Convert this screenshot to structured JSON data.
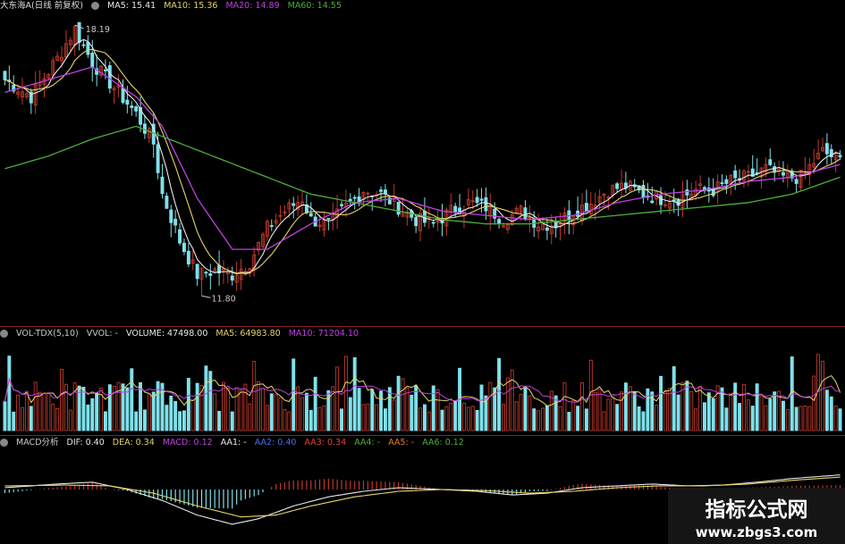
{
  "colors": {
    "up": "#c0392b",
    "down": "#7fe0ea",
    "white": "#e8e8e8",
    "yellow": "#e6d36a",
    "magenta": "#c040e0",
    "green": "#4caf3a",
    "blue": "#4a6be8",
    "red": "#e04040",
    "orange": "#e08020",
    "label": "#c8c8c8"
  },
  "main_header": {
    "title": "大东海A(日线 前复权)",
    "ma5": "MA5: 15.41",
    "ma10": "MA10: 15.36",
    "ma20": "MA20: 14.89",
    "ma60": "MA60: 14.55"
  },
  "vol_header": {
    "title": "VOL-TDX(5,10)",
    "vvol": "VVOL: -",
    "volume": "VOLUME: 47498.00",
    "ma5": "MA5: 64983.80",
    "ma10": "MA10: 71204.10"
  },
  "macd_header": {
    "title": "MACD分析",
    "dif": "DIF: 0.40",
    "dea": "DEA: 0.34",
    "macd": "MACD: 0.12",
    "aa1": "AA1: -",
    "aa2": "AA2: 0.40",
    "aa3": "AA3: 0.34",
    "aa4": "AA4: -",
    "aa5": "AA5: -",
    "aa6": "AA6: 0.12"
  },
  "annotations": {
    "high": "18.19",
    "low": "11.80"
  },
  "watermark": {
    "title": "指标公式网",
    "url": "www.zbgs3.com"
  },
  "chart_data": [
    {
      "type": "candlestick",
      "price_range": [
        11.3,
        18.4
      ],
      "high_value": 18.19,
      "low_value": 11.8,
      "close_keyframes": [
        [
          0,
          16.9
        ],
        [
          6,
          16.5
        ],
        [
          12,
          17.4
        ],
        [
          16,
          18.1
        ],
        [
          20,
          17.3
        ],
        [
          26,
          16.6
        ],
        [
          30,
          16.1
        ],
        [
          34,
          15.4
        ],
        [
          36,
          14.2
        ],
        [
          40,
          13.1
        ],
        [
          44,
          12.3
        ],
        [
          48,
          12.4
        ],
        [
          52,
          12.3
        ],
        [
          56,
          12.6
        ],
        [
          60,
          13.4
        ],
        [
          64,
          13.8
        ],
        [
          68,
          14.1
        ],
        [
          70,
          13.6
        ],
        [
          74,
          13.5
        ],
        [
          78,
          13.9
        ],
        [
          82,
          14.3
        ],
        [
          86,
          14.2
        ],
        [
          90,
          13.9
        ],
        [
          94,
          13.6
        ],
        [
          98,
          13.5
        ],
        [
          102,
          13.8
        ],
        [
          106,
          14.0
        ],
        [
          110,
          13.9
        ],
        [
          114,
          13.6
        ],
        [
          118,
          13.8
        ],
        [
          122,
          13.5
        ],
        [
          126,
          13.5
        ],
        [
          130,
          13.8
        ],
        [
          134,
          14.0
        ],
        [
          138,
          14.3
        ],
        [
          142,
          14.4
        ],
        [
          146,
          14.2
        ],
        [
          150,
          14.1
        ],
        [
          154,
          14.1
        ],
        [
          158,
          14.3
        ],
        [
          162,
          14.3
        ],
        [
          166,
          14.5
        ],
        [
          170,
          14.6
        ],
        [
          174,
          14.8
        ],
        [
          178,
          14.6
        ],
        [
          182,
          14.6
        ],
        [
          187,
          15.2
        ],
        [
          191,
          15.0
        ]
      ],
      "ma_keyframes": {
        "ma20": [
          [
            0,
            16.6
          ],
          [
            10,
            16.9
          ],
          [
            20,
            17.2
          ],
          [
            30,
            16.5
          ],
          [
            36,
            15.8
          ],
          [
            44,
            14.1
          ],
          [
            52,
            12.9
          ],
          [
            60,
            12.9
          ],
          [
            70,
            13.5
          ],
          [
            80,
            14.0
          ],
          [
            90,
            14.1
          ],
          [
            100,
            13.8
          ],
          [
            110,
            13.7
          ],
          [
            120,
            13.6
          ],
          [
            130,
            13.7
          ],
          [
            140,
            14.0
          ],
          [
            150,
            14.2
          ],
          [
            160,
            14.3
          ],
          [
            170,
            14.5
          ],
          [
            180,
            14.6
          ],
          [
            191,
            14.9
          ]
        ],
        "ma60": [
          [
            0,
            14.8
          ],
          [
            10,
            15.1
          ],
          [
            20,
            15.5
          ],
          [
            30,
            15.8
          ],
          [
            40,
            15.4
          ],
          [
            50,
            15.0
          ],
          [
            60,
            14.6
          ],
          [
            70,
            14.2
          ],
          [
            80,
            14.0
          ],
          [
            90,
            13.8
          ],
          [
            100,
            13.6
          ],
          [
            110,
            13.5
          ],
          [
            120,
            13.5
          ],
          [
            130,
            13.6
          ],
          [
            140,
            13.7
          ],
          [
            150,
            13.8
          ],
          [
            160,
            13.9
          ],
          [
            170,
            14.0
          ],
          [
            180,
            14.2
          ],
          [
            191,
            14.6
          ]
        ]
      }
    },
    {
      "type": "bar",
      "name": "volume",
      "last_volume": 47498.0,
      "ma5": 64983.8,
      "ma10": 71204.1
    },
    {
      "type": "histogram",
      "name": "macd",
      "dif": 0.4,
      "dea": 0.34,
      "macd": 0.12,
      "dif_keyframes": [
        [
          0,
          0.05
        ],
        [
          12,
          0.15
        ],
        [
          20,
          0.2
        ],
        [
          28,
          0.0
        ],
        [
          36,
          -0.3
        ],
        [
          44,
          -0.7
        ],
        [
          52,
          -0.95
        ],
        [
          58,
          -0.8
        ],
        [
          66,
          -0.45
        ],
        [
          74,
          -0.2
        ],
        [
          82,
          -0.05
        ],
        [
          90,
          0.05
        ],
        [
          100,
          0.0
        ],
        [
          108,
          -0.05
        ],
        [
          116,
          -0.15
        ],
        [
          124,
          -0.1
        ],
        [
          132,
          0.05
        ],
        [
          140,
          0.1
        ],
        [
          148,
          0.15
        ],
        [
          156,
          0.1
        ],
        [
          164,
          0.12
        ],
        [
          172,
          0.2
        ],
        [
          180,
          0.3
        ],
        [
          191,
          0.4
        ]
      ],
      "dea_keyframes": [
        [
          0,
          0.1
        ],
        [
          14,
          0.12
        ],
        [
          24,
          0.1
        ],
        [
          34,
          -0.1
        ],
        [
          44,
          -0.45
        ],
        [
          54,
          -0.75
        ],
        [
          62,
          -0.7
        ],
        [
          70,
          -0.45
        ],
        [
          80,
          -0.2
        ],
        [
          90,
          -0.05
        ],
        [
          100,
          0.0
        ],
        [
          110,
          -0.03
        ],
        [
          120,
          -0.1
        ],
        [
          130,
          -0.05
        ],
        [
          140,
          0.05
        ],
        [
          150,
          0.1
        ],
        [
          160,
          0.1
        ],
        [
          170,
          0.15
        ],
        [
          180,
          0.25
        ],
        [
          191,
          0.34
        ]
      ]
    }
  ]
}
